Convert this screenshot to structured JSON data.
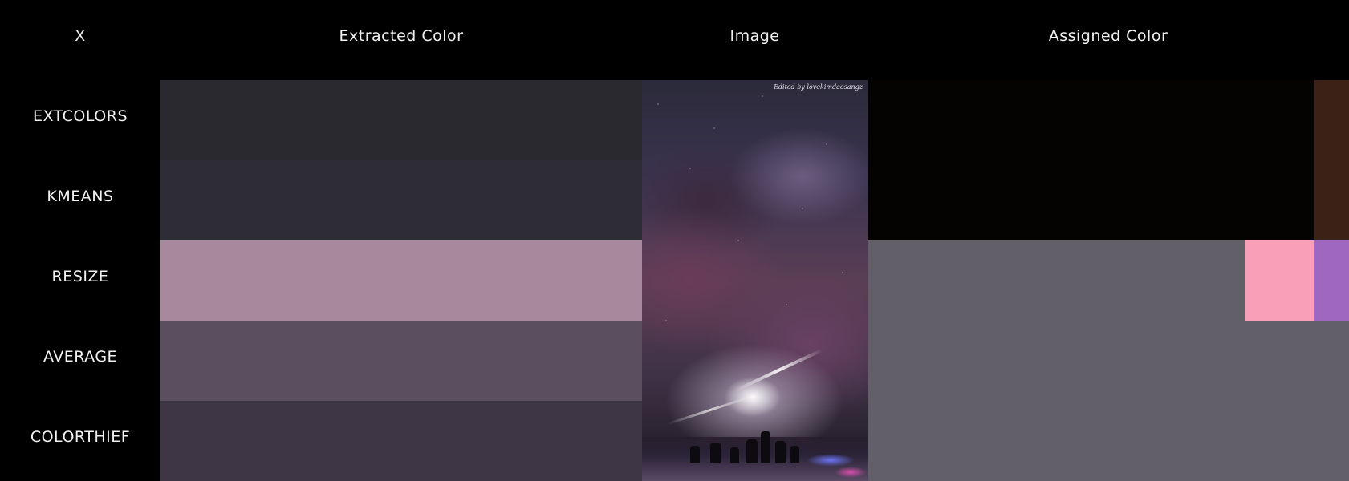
{
  "header": {
    "x_label": "X",
    "extracted_label": "Extracted Color",
    "image_label": "Image",
    "assigned_label": "Assigned Color"
  },
  "rows": [
    {
      "label": "EXTCOLORS",
      "extracted": "#2a292f"
    },
    {
      "label": "KMEANS",
      "extracted": "#2e2c35"
    },
    {
      "label": "RESIZE",
      "extracted": "#a6899c"
    },
    {
      "label": "AVERAGE",
      "extracted": "#5a4e5f"
    },
    {
      "label": "COLORTHIEF",
      "extracted": "#3e3545"
    }
  ],
  "assigned_colors": {
    "near_black": "#050302",
    "brown": "#3b2216",
    "gray": "#625f69",
    "pink": "#f9a0b8",
    "purple": "#a067c0"
  },
  "image": {
    "credit": "Edited by lovekimdaesangz"
  }
}
